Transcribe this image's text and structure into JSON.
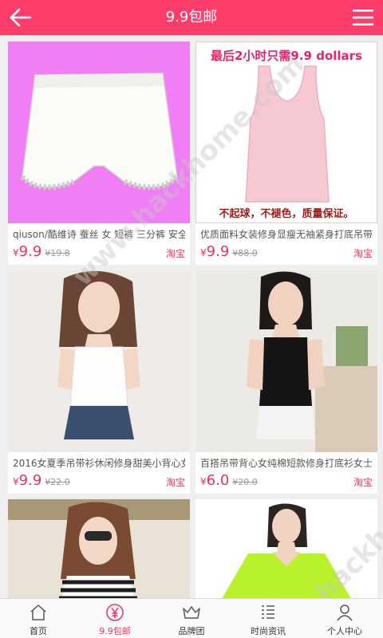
{
  "header": {
    "title": "9.9包邮",
    "back_icon": "back-arrow-icon",
    "menu_icon": "hamburger-menu-icon"
  },
  "colors": {
    "accent": "#fe3d6b",
    "price": "#f0305a"
  },
  "products": [
    {
      "name": "qiuson/酷维诗 蚕丝 女 短裤 三分裤 安全",
      "currency": "¥",
      "price": "9.9",
      "old_price": "¥19.8",
      "shop": "淘宝"
    },
    {
      "name": "优质面料女装修身显瘦无袖紧身打底吊带",
      "currency": "¥",
      "price": "9.9",
      "old_price": "¥88.0",
      "shop": "淘宝",
      "banner_top": "最后2小时只需9.9 dollars",
      "banner_bottom": "不起球，不褪色，质量保证。"
    },
    {
      "name": "2016女夏季吊带衫休闲修身甜美小背心女",
      "currency": "¥",
      "price": "9.9",
      "old_price": "¥22.0",
      "shop": "淘宝"
    },
    {
      "name": "百搭吊带背心女纯棉短款修身打底衫女士",
      "currency": "¥",
      "price": "6.0",
      "old_price": "¥20.0",
      "shop": "淘宝"
    },
    {
      "name": "",
      "currency": "",
      "price": "",
      "old_price": "",
      "shop": ""
    },
    {
      "name": "",
      "currency": "",
      "price": "",
      "old_price": "",
      "shop": ""
    }
  ],
  "tabs": [
    {
      "label": "首页",
      "icon": "home-icon"
    },
    {
      "label": "9.9包邮",
      "icon": "yen-coin-icon"
    },
    {
      "label": "品牌团",
      "icon": "crown-icon"
    },
    {
      "label": "时尚资讯",
      "icon": "news-list-icon"
    },
    {
      "label": "个人中心",
      "icon": "user-icon"
    }
  ]
}
